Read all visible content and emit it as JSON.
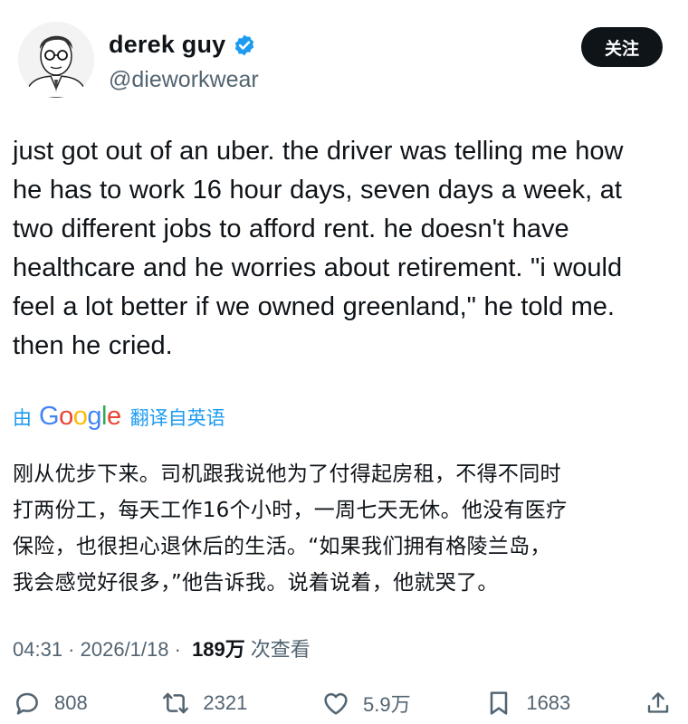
{
  "profile": {
    "display_name": "derek guy",
    "handle": "@dieworkwear",
    "follow_label": "关注"
  },
  "tweet": {
    "text": "just got out of an uber. the driver was telling me how\nhe has to work 16 hour days, seven days a week, at\ntwo different jobs to afford rent. he doesn't have\nhealthcare and he worries about retirement. \"i would\nfeel a lot better if we owned greenland,\" he told me.\nthen he cried."
  },
  "translation": {
    "by_label": "由",
    "google_logo": "Google",
    "from_label": "翻译自英语",
    "text": "刚从优步下来。司机跟我说他为了付得起房租，不得不同时\n打两份工，每天工作16个小时，一周七天无休。他没有医疗\n保险，也很担心退休后的生活。“如果我们拥有格陵兰岛，\n我会感觉好很多，”他告诉我。说着说着，他就哭了。"
  },
  "meta": {
    "time": "04:31",
    "date": "2026/1/18",
    "sep": " · ",
    "views": "189万",
    "views_label": "次查看"
  },
  "actions": {
    "replies": "808",
    "reposts": "2321",
    "likes": "5.9万",
    "bookmarks": "1683"
  },
  "colors": {
    "accent": "#1d9bf0",
    "text": "#0f1419",
    "secondary": "#536471"
  }
}
